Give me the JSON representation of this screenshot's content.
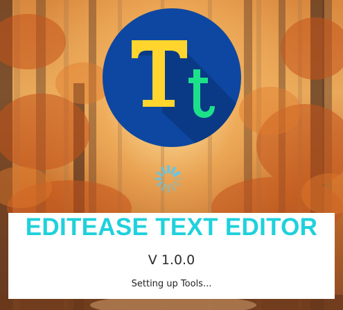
{
  "splash": {
    "app_name": "EDITEASE TEXT EDITOR",
    "version": "V 1.0.0",
    "status": "Setting up Tools...",
    "logo_icon": "text-editor-logo-icon",
    "logo_letters": "Tt",
    "spinner_icon": "loading-spinner-icon"
  },
  "colors": {
    "title": "#1fd1dc",
    "logo_circle": "#0d47a1",
    "logo_big_T": "#ffd52e",
    "logo_small_t": "#1de18a",
    "spinner": "#5ec8ee",
    "panel": "#ffffff"
  }
}
